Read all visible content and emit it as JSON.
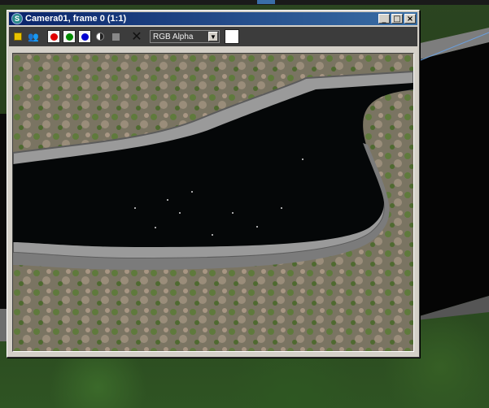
{
  "window": {
    "title": "Camera01, frame 0 (1:1)",
    "app_icon": "3ds-max-icon"
  },
  "title_buttons": {
    "minimize": "_",
    "maximize": "□",
    "close": "×"
  },
  "toolbar": {
    "icons": [
      "save-icon",
      "clone-window-icon",
      "red-channel-icon",
      "green-channel-icon",
      "blue-channel-icon",
      "mono-channel-icon",
      "alpha-square-icon",
      "clear-icon"
    ],
    "channel_dropdown": {
      "selected": "RGB Alpha"
    },
    "channel_colors": {
      "red": "#e00000",
      "green": "#008a00",
      "blue": "#0000d0"
    },
    "swatch_color": "#ffffff"
  },
  "colors": {
    "title_start": "#0a246a",
    "title_end": "#3a6ea5",
    "toolbar_bg": "#3c3c3c",
    "water": "#050708",
    "curb": "#8d8d8d",
    "ground": "#7a7560"
  }
}
